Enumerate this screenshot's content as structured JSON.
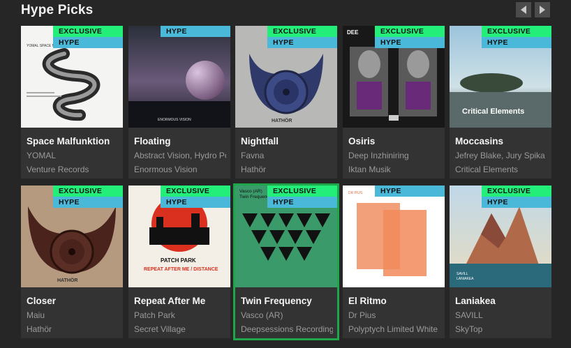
{
  "header": {
    "title": "Hype Picks",
    "prev_icon": "chevron-left-icon",
    "next_icon": "chevron-right-icon"
  },
  "badges": {
    "exclusive": "EXCLUSIVE",
    "hype": "HYPE",
    "exclusive_color": "#23ee7a",
    "hype_color": "#4ab8d8"
  },
  "cards": [
    {
      "title": "Space Malfunktion",
      "artist": "YOMAL",
      "label": "Venture Records",
      "exclusive": true,
      "hype": true,
      "cover_text": "YOMAL SPACE MALFUNKTION"
    },
    {
      "title": "Floating",
      "artist": "Abstract Vision, Hydro Poet",
      "label": "Enormous Vision",
      "exclusive": false,
      "hype": true,
      "cover_text": "ENORMOUS VISION"
    },
    {
      "title": "Nightfall",
      "artist": "Favna",
      "label": "Hathör",
      "exclusive": true,
      "hype": true,
      "cover_text": "HATHÖR"
    },
    {
      "title": "Osiris",
      "artist": "Deep Inzhiniring",
      "label": "Iktan Musik",
      "exclusive": true,
      "hype": true,
      "cover_text": "DEE"
    },
    {
      "title": "Moccasins",
      "artist": "Jefrey Blake, Jury Spika",
      "label": "Critical Elements",
      "exclusive": true,
      "hype": true,
      "cover_text": "Critical Elements"
    },
    {
      "title": "Closer",
      "artist": "Maiu",
      "label": "Hathör",
      "exclusive": true,
      "hype": true,
      "cover_text": "HATHÖR"
    },
    {
      "title": "Repeat After Me",
      "artist": "Patch Park",
      "label": "Secret Village",
      "exclusive": true,
      "hype": true,
      "cover_text": "PATCH PARK",
      "cover_sub": "REPEAT AFTER ME / DISTANCE"
    },
    {
      "title": "Twin Frequency",
      "artist": "Vasco (AR)",
      "label": "Deepsessions Recordings",
      "exclusive": true,
      "hype": true,
      "cover_text": "Vasco (AR)",
      "cover_sub": "Twin Frequency",
      "selected": true
    },
    {
      "title": "El Ritmo",
      "artist": "Dr Pius",
      "label": "Polyptych Limited White",
      "exclusive": false,
      "hype": true,
      "cover_text": "DR PIUS"
    },
    {
      "title": "Laniakea",
      "artist": "SAVILL",
      "label": "SkyTop",
      "exclusive": true,
      "hype": true,
      "cover_text": "SAVILL",
      "cover_sub": "LANIAKEA"
    }
  ]
}
